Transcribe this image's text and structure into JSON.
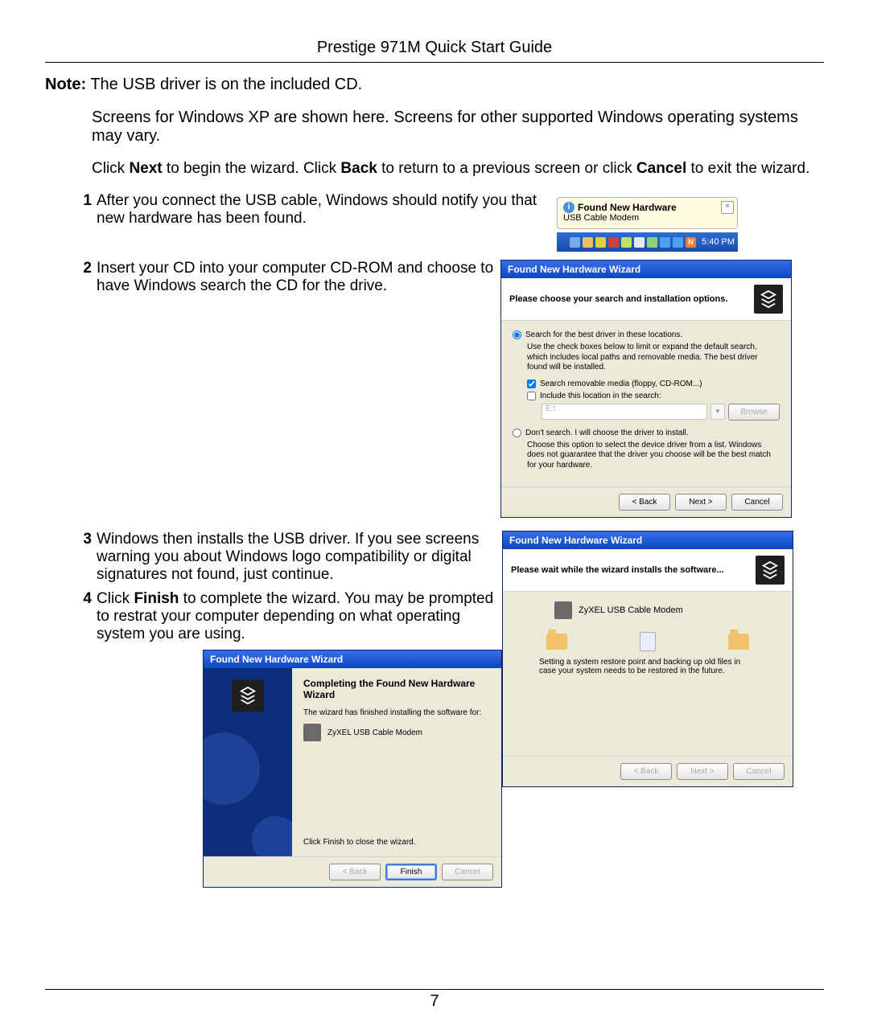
{
  "header": {
    "title": "Prestige 971M Quick Start Guide"
  },
  "note": {
    "label": "Note:",
    "text1": "The USB driver is on the included CD.",
    "text2": "Screens for Windows XP are shown here. Screens for other supported Windows operating systems may vary."
  },
  "instr": {
    "pre": "Click ",
    "next": "Next",
    "mid1": " to begin the wizard. Click ",
    "back": "Back",
    "mid2": " to return to a previous screen or click ",
    "cancel": "Cancel",
    "post": " to exit the wizard."
  },
  "steps": {
    "s1": {
      "num": "1",
      "text": "After you connect the USB cable, Windows should notify you that new hardware has been found."
    },
    "s2": {
      "num": "2",
      "text": "Insert your CD into your computer CD-ROM and choose to have Windows search the CD for the drive."
    },
    "s3": {
      "num": "3",
      "text": "Windows then installs the USB driver. If you see screens warning you about Windows logo compatibility or digital signatures not found, just continue."
    },
    "s4": {
      "num": "4",
      "pre": "Click ",
      "finish": "Finish",
      "post": " to complete the wizard. You may be prompted to restrat your computer depending on what operating system you are using."
    }
  },
  "balloon": {
    "title": "Found New Hardware",
    "body": "USB Cable Modem",
    "close": "×"
  },
  "tray": {
    "time": "5:40 PM"
  },
  "wizard_title": "Found New Hardware Wizard",
  "wiz1": {
    "header": "Please choose your search and installation options.",
    "opt_search": "Search for the best driver in these locations.",
    "opt_search_desc": "Use the check boxes below to limit or expand the default search, which includes local paths and removable media. The best driver found will be installed.",
    "chk_removable": "Search removable media (floppy, CD-ROM...)",
    "chk_include": "Include this location in the search:",
    "location": "E:\\",
    "browse": "Browse",
    "opt_dont": "Don't search. I will choose the driver to install.",
    "opt_dont_desc": "Choose this option to select the device driver from a list. Windows does not guarantee that the driver you choose will be the best match for your hardware.",
    "back": "< Back",
    "next": "Next >",
    "cancel": "Cancel"
  },
  "wiz2": {
    "header": "Please wait while the wizard installs the software...",
    "device": "ZyXEL USB Cable Modem",
    "restore": "Setting a system restore point and backing up old files in case your system needs to be restored in the future.",
    "back": "< Back",
    "next": "Next >",
    "cancel": "Cancel"
  },
  "wiz3": {
    "heading": "Completing the Found New Hardware Wizard",
    "finished": "The wizard has finished installing the software for:",
    "device": "ZyXEL USB Cable Modem",
    "close_text": "Click Finish to close the wizard.",
    "back": "< Back",
    "finish": "Finish",
    "cancel": "Cancel"
  },
  "page_number": "7"
}
